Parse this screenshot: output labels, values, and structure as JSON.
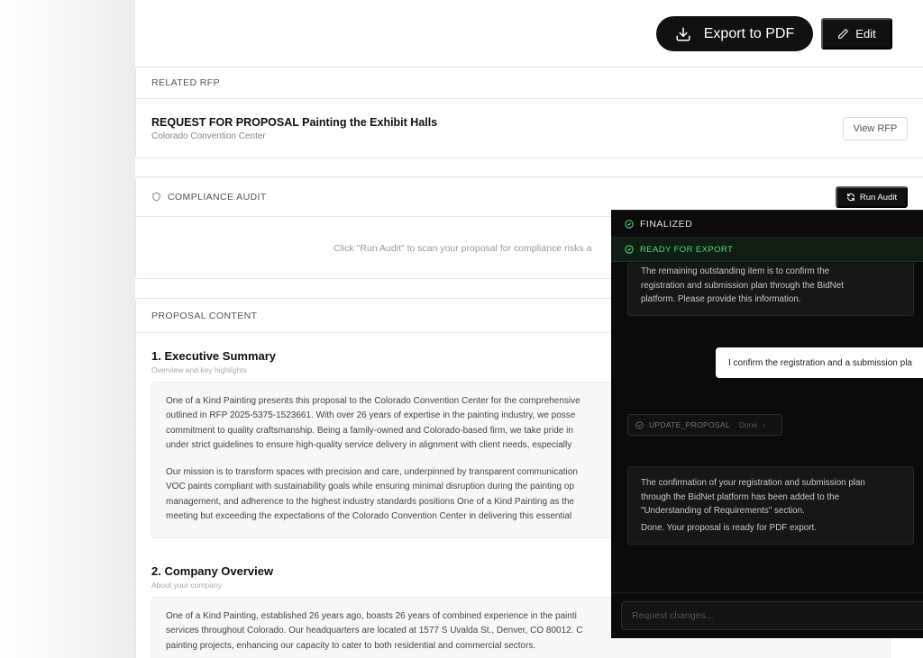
{
  "toolbar": {
    "export_label": "Export to PDF",
    "edit_label": "Edit"
  },
  "related_rfp": {
    "header": "RELATED RFP",
    "title": "REQUEST FOR PROPOSAL Painting the Exhibit Halls",
    "organization": "Colorado Convention Center",
    "view_label": "View RFP"
  },
  "audit": {
    "header": "COMPLIANCE AUDIT",
    "run_label": "Run Audit",
    "hint": "Click \"Run Audit\" to scan your proposal for compliance risks a"
  },
  "proposal": {
    "header": "PROPOSAL CONTENT",
    "sections": [
      {
        "title": "1. Executive Summary",
        "subtitle": "Overview and key highlights",
        "p1": [
          "One of a Kind Painting presents this proposal to the Colorado Convention Center for the comprehensive",
          "outlined in RFP 2025-5375-1523661. With over 26 years of expertise in the painting industry, we posse",
          "commitment to quality craftsmanship. Being a family-owned and Colorado-based firm, we take pride in",
          "under strict guidelines to ensure high-quality service delivery in alignment with client needs, especially"
        ],
        "p2": [
          "Our mission is to transform spaces with precision and care, underpinned by transparent communication",
          "VOC paints compliant with sustainability goals while ensuring minimal disruption during the painting op",
          "management, and adherence to the highest industry standards positions One of a Kind Painting as the",
          "meeting but exceeding the expectations of the Colorado Convention Center in delivering this essential"
        ]
      },
      {
        "title": "2. Company Overview",
        "subtitle": "About your company",
        "p1": [
          "One of a Kind Painting, established 26 years ago, boasts 26 years of combined experience in the painti",
          "services throughout Colorado. Our headquarters are located at 1577 S Uvalda St., Denver, CO 80012. C",
          "painting projects, enhancing our capacity to cater to both residential and commercial sectors."
        ]
      }
    ]
  },
  "chat": {
    "status": "FINALIZED",
    "ready": "READY FOR EXPORT",
    "msg1": [
      "The remaining outstanding item is to confirm the",
      "registration and submission plan through the BidNet",
      "platform. Please provide this information."
    ],
    "user_msg": "I confirm the registration and a submission pla",
    "tool_name": "UPDATE_PROPOSAL",
    "tool_status": "Done",
    "msg2": [
      "The confirmation of your registration and submission plan",
      "through the BidNet platform has been added to the",
      "\"Understanding of Requirements\" section."
    ],
    "msg2_done": "Done. Your proposal is ready for PDF export.",
    "input_placeholder": "Request changes..."
  }
}
